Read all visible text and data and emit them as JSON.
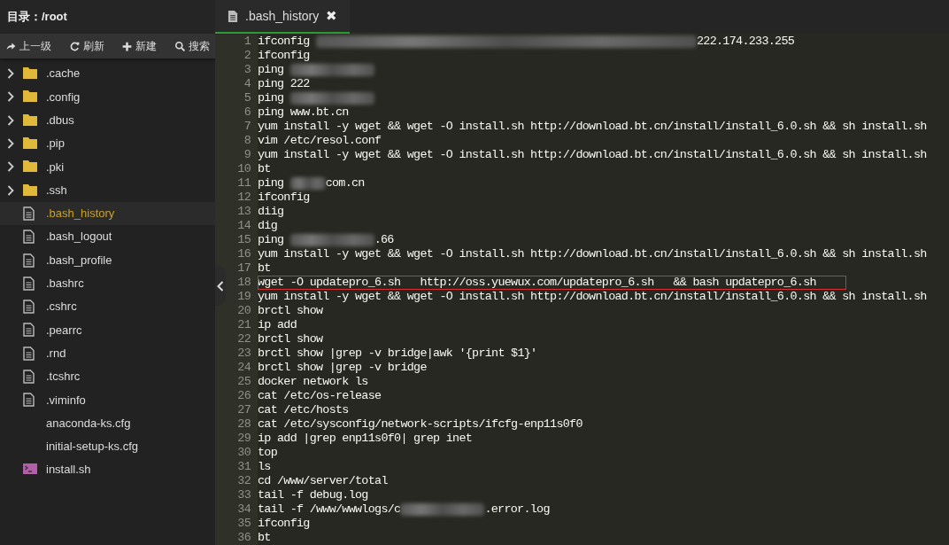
{
  "sidebar": {
    "title": "目录：/root",
    "toolbar": [
      {
        "kind": "up",
        "label": "上一级"
      },
      {
        "kind": "refresh",
        "label": "刷新"
      },
      {
        "kind": "new",
        "label": "新建"
      },
      {
        "kind": "search",
        "label": "搜索"
      }
    ],
    "items": [
      {
        "kind": "folder",
        "name": ".cache",
        "selected": false
      },
      {
        "kind": "folder",
        "name": ".config",
        "selected": false
      },
      {
        "kind": "folder",
        "name": ".dbus",
        "selected": false
      },
      {
        "kind": "folder",
        "name": ".pip",
        "selected": false
      },
      {
        "kind": "folder",
        "name": ".pki",
        "selected": false
      },
      {
        "kind": "folder",
        "name": ".ssh",
        "selected": false
      },
      {
        "kind": "file",
        "name": ".bash_history",
        "selected": true
      },
      {
        "kind": "file",
        "name": ".bash_logout",
        "selected": false
      },
      {
        "kind": "file",
        "name": ".bash_profile",
        "selected": false
      },
      {
        "kind": "file",
        "name": ".bashrc",
        "selected": false
      },
      {
        "kind": "file",
        "name": ".cshrc",
        "selected": false
      },
      {
        "kind": "file",
        "name": ".pearrc",
        "selected": false
      },
      {
        "kind": "file",
        "name": ".rnd",
        "selected": false
      },
      {
        "kind": "file",
        "name": ".tcshrc",
        "selected": false
      },
      {
        "kind": "file",
        "name": ".viminfo",
        "selected": false
      },
      {
        "kind": "plain",
        "name": "anaconda-ks.cfg",
        "selected": false
      },
      {
        "kind": "plain",
        "name": "initial-setup-ks.cfg",
        "selected": false
      },
      {
        "kind": "script",
        "name": "install.sh",
        "selected": false
      }
    ]
  },
  "tabs": [
    {
      "label": ".bash_history",
      "close": "✖",
      "selected": true
    }
  ],
  "editor": {
    "lines": [
      {
        "number": "1",
        "parts": [
          {
            "kind": "text",
            "text": "ifconfig "
          },
          {
            "kind": "blur_long"
          },
          {
            "kind": "text",
            "text": "222.174.233.255"
          }
        ]
      },
      {
        "number": "2",
        "parts": [
          {
            "kind": "text",
            "text": "ifconfig"
          }
        ]
      },
      {
        "number": "3",
        "parts": [
          {
            "kind": "text",
            "text": "ping "
          },
          {
            "kind": "blur_short"
          }
        ]
      },
      {
        "number": "4",
        "parts": [
          {
            "kind": "text",
            "text": "ping 222"
          }
        ]
      },
      {
        "number": "5",
        "parts": [
          {
            "kind": "text",
            "text": "ping "
          },
          {
            "kind": "blur_short"
          }
        ]
      },
      {
        "number": "6",
        "parts": [
          {
            "kind": "text",
            "text": "ping www.bt.cn"
          }
        ]
      },
      {
        "number": "7",
        "parts": [
          {
            "kind": "text",
            "text": "yum install -y wget && wget -O install.sh http://download.bt.cn/install/install_6.0.sh && sh install.sh"
          }
        ]
      },
      {
        "number": "8",
        "parts": [
          {
            "kind": "text",
            "text": "vim /etc/resol.conf"
          }
        ]
      },
      {
        "number": "9",
        "parts": [
          {
            "kind": "text",
            "text": "yum install -y wget && wget -O install.sh http://download.bt.cn/install/install_6.0.sh && sh install.sh"
          }
        ]
      },
      {
        "number": "10",
        "parts": [
          {
            "kind": "text",
            "text": "bt"
          }
        ]
      },
      {
        "number": "11",
        "parts": [
          {
            "kind": "text",
            "text": "ping "
          },
          {
            "kind": "blur_tiny"
          },
          {
            "kind": "text",
            "text": "com.cn"
          }
        ]
      },
      {
        "number": "12",
        "parts": [
          {
            "kind": "text",
            "text": "ifconfig"
          }
        ]
      },
      {
        "number": "13",
        "parts": [
          {
            "kind": "text",
            "text": "diig"
          }
        ]
      },
      {
        "number": "14",
        "parts": [
          {
            "kind": "text",
            "text": "dig"
          }
        ]
      },
      {
        "number": "15",
        "parts": [
          {
            "kind": "text",
            "text": "ping "
          },
          {
            "kind": "blur_short"
          },
          {
            "kind": "text",
            "text": ".66"
          }
        ]
      },
      {
        "number": "16",
        "parts": [
          {
            "kind": "text",
            "text": "yum install -y wget && wget -O install.sh http://download.bt.cn/install/install_6.0.sh && sh install.sh"
          }
        ]
      },
      {
        "number": "17",
        "parts": [
          {
            "kind": "text",
            "text": "bt"
          }
        ]
      },
      {
        "number": "18",
        "highlighted": true,
        "parts": [
          {
            "kind": "text",
            "text": "wget -O updatepro_6.sh   http://oss.yuewux.com/updatepro_6.sh   && bash updatepro_6.sh"
          }
        ]
      },
      {
        "number": "19",
        "parts": [
          {
            "kind": "text",
            "text": "yum install -y wget && wget -O install.sh http://download.bt.cn/install/install_6.0.sh && sh install.sh"
          }
        ]
      },
      {
        "number": "20",
        "parts": [
          {
            "kind": "text",
            "text": "brctl show"
          }
        ]
      },
      {
        "number": "21",
        "parts": [
          {
            "kind": "text",
            "text": "ip add"
          }
        ]
      },
      {
        "number": "22",
        "parts": [
          {
            "kind": "text",
            "text": "brctl show"
          }
        ]
      },
      {
        "number": "23",
        "parts": [
          {
            "kind": "text",
            "text": "brctl show |grep -v bridge|awk '{print $1}'"
          }
        ]
      },
      {
        "number": "24",
        "parts": [
          {
            "kind": "text",
            "text": "brctl show |grep -v bridge"
          }
        ]
      },
      {
        "number": "25",
        "parts": [
          {
            "kind": "text",
            "text": "docker network ls"
          }
        ]
      },
      {
        "number": "26",
        "parts": [
          {
            "kind": "text",
            "text": "cat /etc/os-release"
          }
        ]
      },
      {
        "number": "27",
        "parts": [
          {
            "kind": "text",
            "text": "cat /etc/hosts"
          }
        ]
      },
      {
        "number": "28",
        "parts": [
          {
            "kind": "text",
            "text": "cat /etc/sysconfig/network-scripts/ifcfg-enp11s0f0"
          }
        ]
      },
      {
        "number": "29",
        "parts": [
          {
            "kind": "text",
            "text": "ip add |grep enp11s0f0| grep inet"
          }
        ]
      },
      {
        "number": "30",
        "parts": [
          {
            "kind": "text",
            "text": "top"
          }
        ]
      },
      {
        "number": "31",
        "parts": [
          {
            "kind": "text",
            "text": "ls"
          }
        ]
      },
      {
        "number": "32",
        "parts": [
          {
            "kind": "text",
            "text": "cd /www/server/total"
          }
        ]
      },
      {
        "number": "33",
        "parts": [
          {
            "kind": "text",
            "text": "tail -f debug.log"
          }
        ]
      },
      {
        "number": "34",
        "parts": [
          {
            "kind": "text",
            "text": "tail -f /www/wwwlogs/c"
          },
          {
            "kind": "blur_short"
          },
          {
            "kind": "text",
            "text": ".error.log"
          }
        ]
      },
      {
        "number": "35",
        "parts": [
          {
            "kind": "text",
            "text": "ifconfig"
          }
        ]
      },
      {
        "number": "36",
        "parts": [
          {
            "kind": "text",
            "text": "bt"
          }
        ]
      }
    ]
  }
}
